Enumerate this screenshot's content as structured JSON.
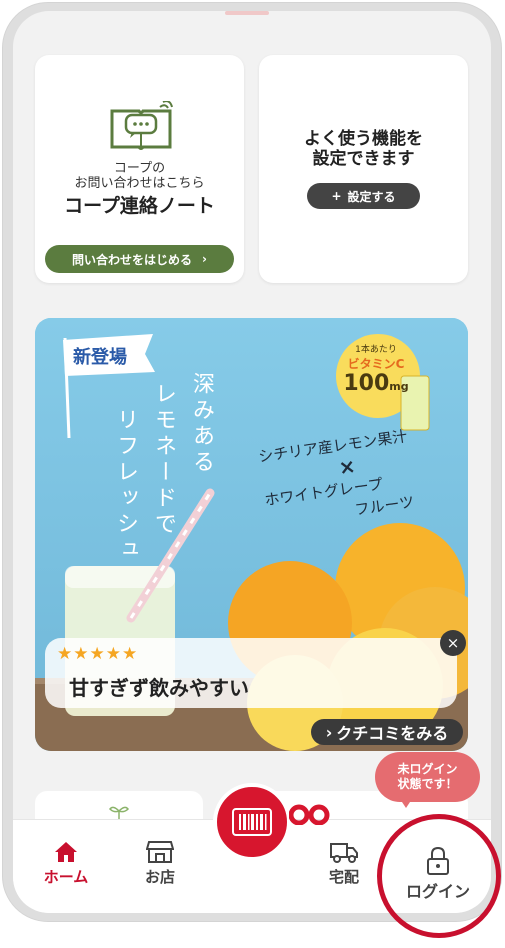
{
  "contact_card": {
    "line1": "コープの",
    "line2": "お問い合わせはこちら",
    "title": "コープ連絡ノート",
    "button_label": "問い合わせをはじめる",
    "button_arrow": "›"
  },
  "settings_card": {
    "title_line1": "よく使う機能を",
    "title_line2": "設定できます",
    "button_plus": "+",
    "button_label": "設定する"
  },
  "banner": {
    "flag_text": "新登場",
    "vertical_col1": "深みある",
    "vertical_col2": "レモネードで",
    "vertical_col3": "リフレッシュ",
    "product_line1": "シチリア産レモン果汁",
    "product_cross": "×",
    "product_line2": "ホワイトグレープ",
    "product_line3": "フルーツ",
    "vitamin_small": "1本あたり",
    "vitamin_label": "ビタミンC",
    "vitamin_amount": "100",
    "vitamin_unit": "mg",
    "review_stars": "★★★★★",
    "review_text": "甘すぎず飲みやすい",
    "close_label": "×",
    "kuchikomi_arrow": "›",
    "kuchikomi_label": "クチコミをみる"
  },
  "nav": {
    "home_label": "ホーム",
    "store_label": "お店",
    "delivery_label": "宅配",
    "login_label": "ログイン"
  },
  "login_bubble": {
    "line1": "未ログイン",
    "line2": "状態です！"
  },
  "colors": {
    "accent_red": "#c8102e",
    "green": "#5b7c3f",
    "banner_sky": "#7cc4e3"
  }
}
